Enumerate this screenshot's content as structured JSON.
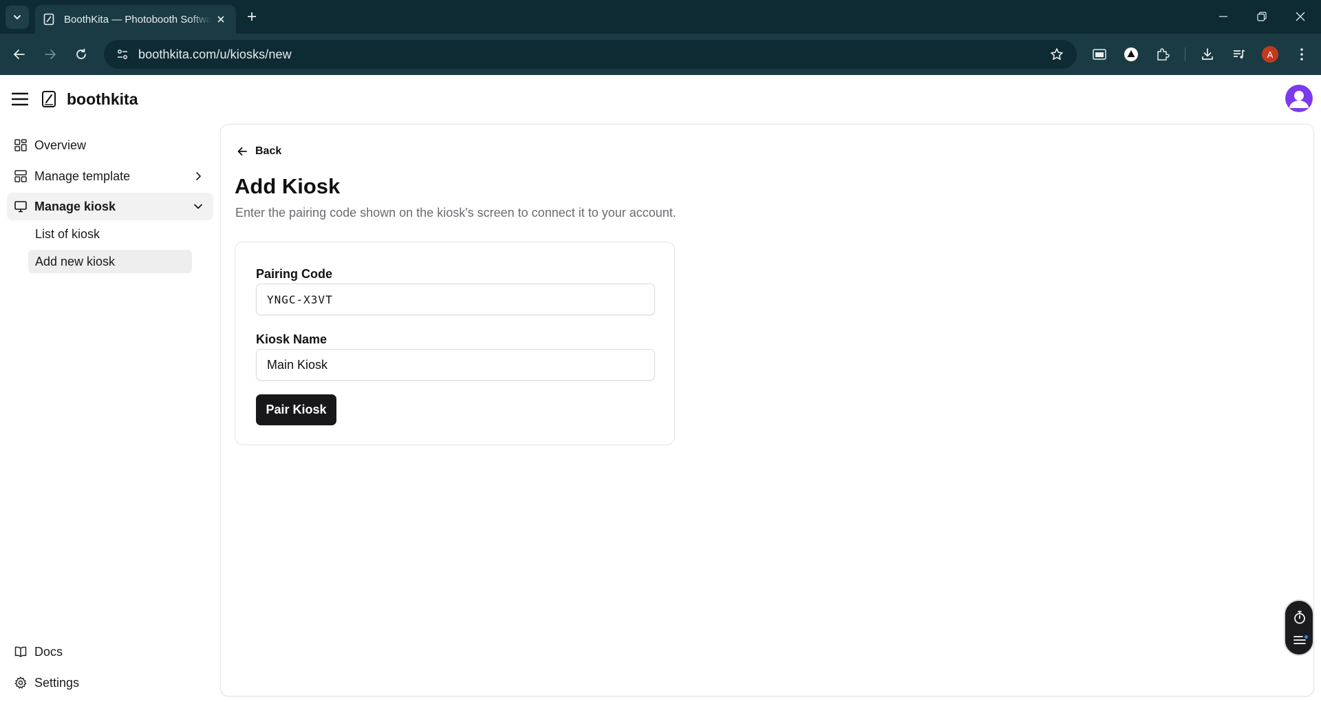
{
  "browser": {
    "tab_title": "BoothKita — Photobooth Software",
    "url": "boothkita.com/u/kiosks/new",
    "profile_initial": "A"
  },
  "app": {
    "brand": "boothkita"
  },
  "sidebar": {
    "items": [
      {
        "label": "Overview",
        "icon": "grid-icon"
      },
      {
        "label": "Manage template",
        "icon": "layout-icon"
      },
      {
        "label": "Manage kiosk",
        "icon": "monitor-icon"
      }
    ],
    "kiosk_subitems": [
      {
        "label": "List of kiosk"
      },
      {
        "label": "Add new kiosk"
      }
    ],
    "bottom": [
      {
        "label": "Docs",
        "icon": "book-icon"
      },
      {
        "label": "Settings",
        "icon": "gear-icon"
      }
    ]
  },
  "page": {
    "back_label": "Back",
    "title": "Add Kiosk",
    "subtitle": "Enter the pairing code shown on the kiosk's screen to connect it to your account."
  },
  "form": {
    "pairing_code_label": "Pairing Code",
    "pairing_code_value": "YNGC-X3VT",
    "kiosk_name_label": "Kiosk Name",
    "kiosk_name_value": "Main Kiosk",
    "submit_label": "Pair Kiosk"
  },
  "colors": {
    "browser_frame": "#0e2a33",
    "toolbar": "#1b3b44",
    "primary_button": "#18181b",
    "avatar_accent": "#7c3aed",
    "profile_badge": "#c23a1e"
  }
}
